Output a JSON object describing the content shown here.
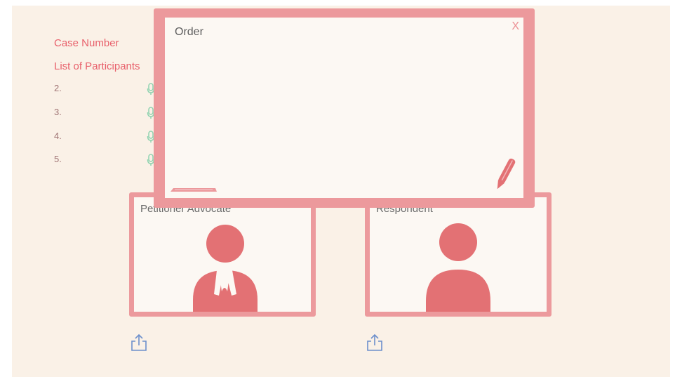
{
  "case": {
    "case_number_label": "Case Number"
  },
  "participants": {
    "title": "List of Participants",
    "rows": [
      {
        "num": "2."
      },
      {
        "num": "3."
      },
      {
        "num": "4."
      },
      {
        "num": "5."
      }
    ]
  },
  "panels": {
    "petitioner": {
      "label": "Petitioner Advocate"
    },
    "respondent": {
      "label": "Respondent"
    }
  },
  "modal": {
    "title": "Order",
    "close_label": "X"
  },
  "icons": {
    "mic": "microphone-icon",
    "upload": "upload-icon",
    "pen": "pen-icon",
    "avatar": "person-icon"
  },
  "colors": {
    "background": "#faf1e7",
    "accent_pink": "#ec999c",
    "avatar": "#e37174",
    "text_accent": "#e8606b",
    "mic": "#8fd3b0",
    "upload": "#6c8fcc"
  }
}
